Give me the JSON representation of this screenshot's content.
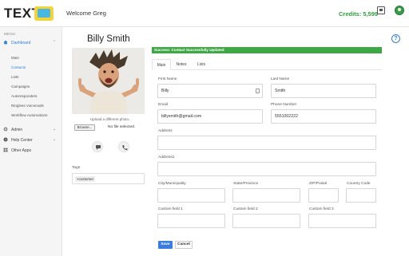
{
  "header": {
    "logo_text": "TEXT",
    "welcome": "Welcome Greg",
    "credits": "Credits: 5,599"
  },
  "sidebar": {
    "menu_label": "MENU",
    "dashboard": "Dashboard",
    "sub_items": [
      "Main",
      "Contacts",
      "Lists",
      "Campaigns",
      "Autoresponders",
      "Ringless Voicemails",
      "Workflow Automations"
    ],
    "active_sub": "Contacts",
    "admin": "Admin",
    "help_center": "Help Center",
    "other_apps": "Other Apps"
  },
  "profile": {
    "name": "Billy Smith",
    "upload_note": "Upload a different photo...",
    "browse_label": "Browse...",
    "no_file": "No file selected.",
    "tags_label": "Tags",
    "tags": [
      "customer"
    ]
  },
  "alert": {
    "text": "Success: Contact Successfully Updated"
  },
  "tabs": [
    "Main",
    "Notes",
    "Lists"
  ],
  "form": {
    "first_name_label": "First Name",
    "first_name": "Billy",
    "last_name_label": "Last Name",
    "last_name": "Smith",
    "email_label": "Email",
    "email": "billysmith@gmail.com",
    "phone_label": "Phone Number",
    "phone": "5551002222",
    "address_label": "Address",
    "address": "",
    "address2_label": "Address2",
    "address2": "",
    "city_label": "City/Municipality",
    "state_label": "State/Province",
    "zip_label": "ZIP/Postal",
    "country_label": "Country Code",
    "custom1_label": "Custom field 1",
    "custom2_label": "Custom field 2",
    "custom3_label": "Custom field 3"
  },
  "buttons": {
    "save": "Save",
    "cancel": "Cancel"
  },
  "colors": {
    "accent": "#2f7ed8",
    "success": "#3ea844",
    "credits": "#2e9c3b"
  }
}
